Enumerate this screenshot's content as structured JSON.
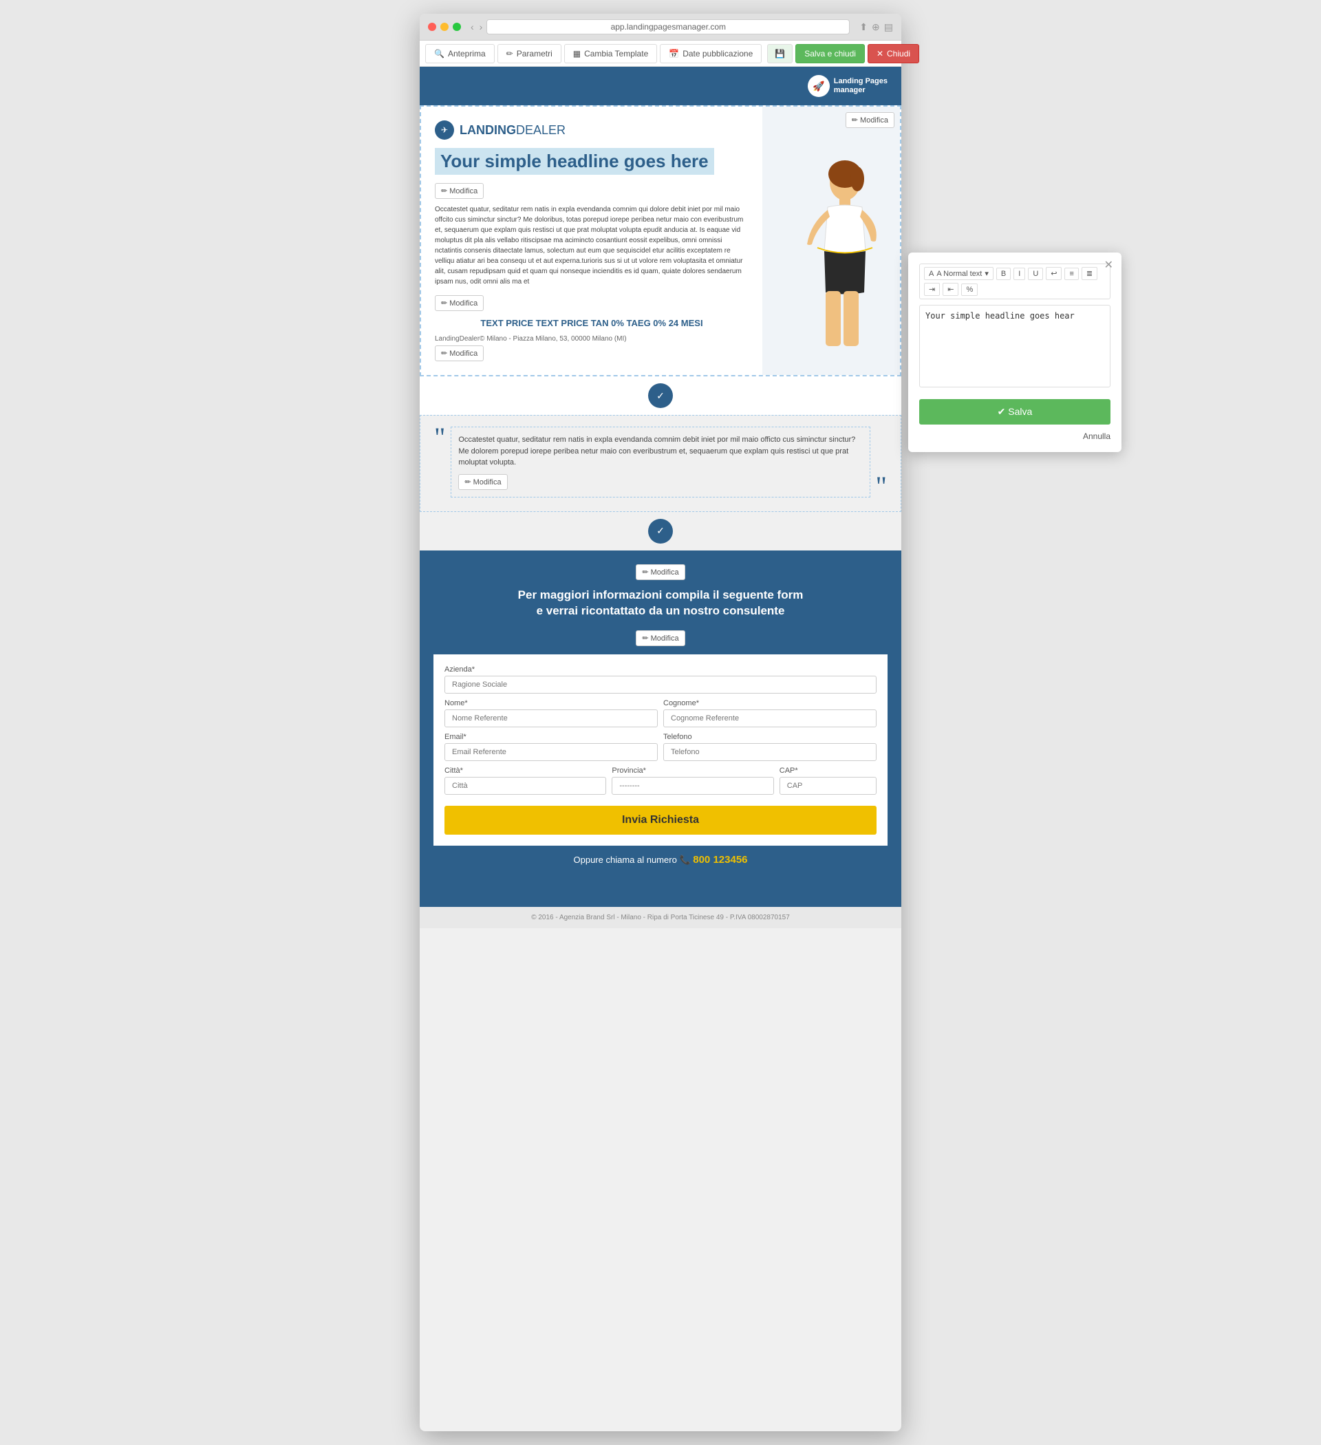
{
  "browser": {
    "url": "app.landingpagesmanager.com",
    "dots": [
      "red",
      "yellow",
      "green"
    ]
  },
  "toolbar": {
    "anteprima": "Anteprima",
    "parametri": "Parametri",
    "cambia_template": "Cambia Template",
    "date_pubblicazione": "Date pubblicazione",
    "salva_e_chiudi": "Salva e chiudi",
    "chiudi": "Chiudi"
  },
  "header": {
    "logo_text_line1": "Landing Pages",
    "logo_text_line2": "manager"
  },
  "hero": {
    "brand_name": "LANDING",
    "brand_suffix": "DEALER",
    "headline": "Your simple headline goes here",
    "body_text": "Occatestet quatur, seditatur rem natis in expla evendanda comnim qui dolore debit iniet por mil maio offcito cus siminctur sinctur? Me doloribus, totas porepud iorepe peribea netur maio con everibustrum et, sequaerum que explam quis restisci ut que prat moluptat volupta epudit anducia at. Is eaquae vid moluptus dit pla alis vellabo ritiscipsae ma acimincto cosantiunt eossit expelibus, omni omnissi nctatintis consenis ditaectate lamus, solectum aut eum que sequiscidel etur acilitis exceptatem re velliqu atiatur ari bea consequ ut et aut experna.turioris sus si ut ut volore rem voluptasita et omniatur alit, cusam repudipsam quid et quam qui nonseque incienditis es id quam, quiate dolores sendaerum ipsam nus, odit omni alis ma et",
    "price_text": "TEXT PRICE TEXT PRICE TAN 0% TAEG 0% 24 MESI",
    "address": "LandingDealer© Milano - Piazza Milano, 53, 00000 Milano (MI)",
    "modifica_label": "✏ Modifica"
  },
  "testimonial": {
    "text": "Occatestet quatur, seditatur rem natis in expla evendanda comnim debit iniet por mil maio officto cus siminctur sinctur? Me dolorem porepud iorepe peribea netur maio con everibustrum et, sequaerum que explam quis restisci ut que prat moluptat volupta.",
    "modifica_label": "✏ Modifica"
  },
  "form_section": {
    "heading": "Per maggiori informazioni compila il seguente form\ne verrai ricontattato da un nostro consulente",
    "modifica_label": "✏ Modifica",
    "fields": {
      "azienda_label": "Azienda*",
      "azienda_placeholder": "Ragione Sociale",
      "nome_label": "Nome*",
      "nome_placeholder": "Nome Referente",
      "cognome_label": "Cognome*",
      "cognome_placeholder": "Cognome Referente",
      "email_label": "Email*",
      "email_placeholder": "Email Referente",
      "telefono_label": "Telefono",
      "telefono_placeholder": "Telefono",
      "citta_label": "Città*",
      "citta_placeholder": "Città",
      "provincia_label": "Provincia*",
      "provincia_placeholder": "--------",
      "cap_label": "CAP*",
      "cap_placeholder": "CAP"
    },
    "submit_label": "Invia Richiesta",
    "phone_line": "Oppure chiama al numero",
    "phone_icon": "📞",
    "phone_number": "800 123456"
  },
  "footer": {
    "text": "© 2016 - Agenzia Brand Srl - Milano - Ripa di Porta Ticinese 49 - P.IVA 08002870157"
  },
  "popup": {
    "style_label": "A Normal text",
    "chevron": "▾",
    "toolbar_bold": "B",
    "toolbar_italic": "I",
    "toolbar_underline": "U",
    "toolbar_undo": "↩",
    "toolbar_list1": "≡",
    "toolbar_list2": "≣",
    "toolbar_indent": "⇥",
    "toolbar_outdent": "⇤",
    "toolbar_link": "%",
    "content": "Your simple headline goes hear",
    "save_label": "✔ Salva",
    "cancel_label": "Annulla"
  }
}
